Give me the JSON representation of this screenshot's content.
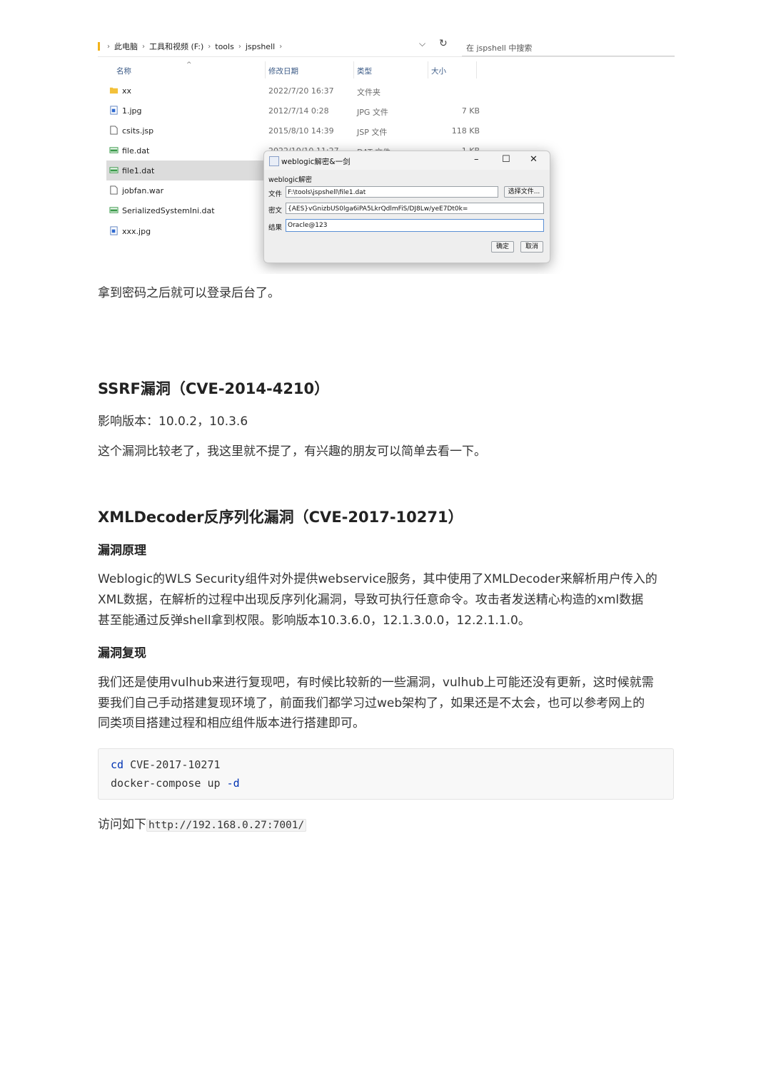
{
  "explorer": {
    "breadcrumb": [
      "此电脑",
      "工具和视频 (F:)",
      "tools",
      "jspshell"
    ],
    "search_placeholder": "在 jspshell 中搜索",
    "columns": {
      "name": "名称",
      "date": "修改日期",
      "type": "类型",
      "size": "大小"
    },
    "files": [
      {
        "name": "xx",
        "date": "2022/7/20 16:37",
        "type": "文件夹",
        "size": "",
        "icon": "folder-icon"
      },
      {
        "name": "1.jpg",
        "date": "2012/7/14 0:28",
        "type": "JPG 文件",
        "size": "7 KB",
        "icon": "image-file-icon"
      },
      {
        "name": "csits.jsp",
        "date": "2015/8/10 14:39",
        "type": "JSP 文件",
        "size": "118 KB",
        "icon": "file-icon"
      },
      {
        "name": "file.dat",
        "date": "2022/10/10 11:27",
        "type": "DAT 文件",
        "size": "1 KB",
        "icon": "dat-file-icon"
      },
      {
        "name": "file1.dat",
        "date": "",
        "type": "",
        "size": "",
        "icon": "dat-file-icon",
        "selected": true
      },
      {
        "name": "jobfan.war",
        "date": "",
        "type": "",
        "size": "",
        "icon": "file-icon"
      },
      {
        "name": "SerializedSystemIni.dat",
        "date": "",
        "type": "",
        "size": "",
        "icon": "dat-file-icon"
      },
      {
        "name": "xxx.jpg",
        "date": "",
        "type": "",
        "size": "",
        "icon": "image-file-icon"
      }
    ]
  },
  "dialog": {
    "title": "weblogic解密&一剑",
    "group_label": "weblogic解密",
    "file_label": "文件",
    "file_value": "F:\\tools\\jspshell\\file1.dat",
    "choose_button": "选择文件...",
    "cipher_label": "密文",
    "cipher_value": "{AES}vGnizbUS0lga6iPA5LkrQdlmFiS/DJ8Lw/yeE7Dt0k=",
    "result_label": "结果",
    "result_value": "Oracle@123",
    "ok_button": "确定",
    "cancel_button": "取消"
  },
  "article": {
    "p_after_shot": "拿到密码之后就可以登录后台了。",
    "h_ssrf": "SSRF漏洞（CVE-2014-4210）",
    "ssrf_versions": "影响版本：10.0.2，10.3.6",
    "ssrf_note": "这个漏洞比较老了，我这里就不提了，有兴趣的朋友可以简单去看一下。",
    "h_xml": "XMLDecoder反序列化漏洞（CVE-2017-10271）",
    "h_principle": "漏洞原理",
    "principle_lines": [
      "Weblogic的WLS Security组件对外提供webservice服务，其中使用了XMLDecoder来解析用户传入的",
      "XML数据，在解析的过程中出现反序列化漏洞，导致可执行任意命令。攻击者发送精心构造的xml数据",
      "甚至能通过反弹shell拿到权限。影响版本10.3.6.0，12.1.3.0.0，12.2.1.1.0。"
    ],
    "h_repro": "漏洞复现",
    "repro_lines": [
      "我们还是使用vulhub来进行复现吧，有时候比较新的一些漏洞，vulhub上可能还没有更新，这时候就需",
      "要我们自己手动搭建复现环境了，前面我们都学习过web架构了，如果还是不太会，也可以参考网上的",
      "同类项目搭建过程和相应组件版本进行搭建即可。"
    ],
    "code": {
      "line1_kw": "cd",
      "line1_rest": " CVE-2017-10271",
      "line2_main": "docker-compose up ",
      "line2_kw": "-d"
    },
    "visit_prefix": "访问如下",
    "visit_url": "http://192.168.0.27:7001/"
  }
}
